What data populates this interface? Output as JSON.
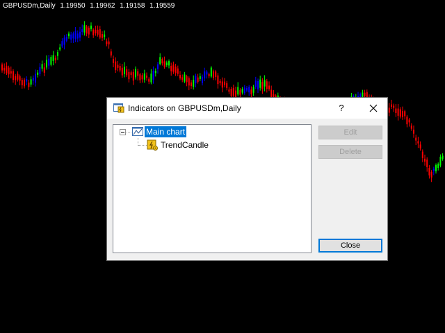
{
  "chart": {
    "header": {
      "symbol": "GBPUSDm,Daily",
      "open": "1.19950",
      "high": "1.19962",
      "low": "1.19158",
      "close": "1.19559"
    },
    "colors": {
      "background": "#000000",
      "bull": "#00ff00",
      "bear": "#ff0000",
      "trend_up": "#0000ff",
      "trend_down": "#ff0000"
    }
  },
  "dialog": {
    "title": "Indicators on GBPUSDm,Daily",
    "help_label": "?",
    "tree": {
      "root_label": "Main chart",
      "children": [
        {
          "label": "TrendCandle"
        }
      ]
    },
    "buttons": {
      "edit": "Edit",
      "delete": "Delete",
      "close": "Close"
    }
  }
}
